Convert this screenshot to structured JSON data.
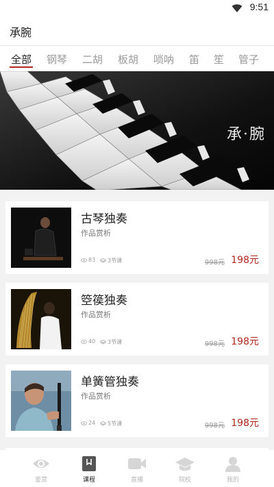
{
  "status": {
    "time": "9:51"
  },
  "app": {
    "title": "承腕"
  },
  "tabs": [
    "全部",
    "钢琴",
    "二胡",
    "板胡",
    "唢呐",
    "笛",
    "笙",
    "管子"
  ],
  "active_tab": "全部",
  "banner": {
    "text": "承·腕"
  },
  "courses": [
    {
      "title": "古琴独奏",
      "subtitle": "作品赏析",
      "views": "83",
      "lessons": "3节课",
      "old_price": "998元",
      "price": "198元"
    },
    {
      "title": "箜篌独奏",
      "subtitle": "作品赏析",
      "views": "40",
      "lessons": "3节课",
      "old_price": "998元",
      "price": "198元"
    },
    {
      "title": "单簧管独奏",
      "subtitle": "作品赏析",
      "views": "24",
      "lessons": "5节课",
      "old_price": "998元",
      "price": "198元"
    }
  ],
  "nav": [
    "鉴赏",
    "课程",
    "直播",
    "院校",
    "我的"
  ],
  "active_nav": "课程",
  "colors": {
    "accent": "#b0281e"
  }
}
